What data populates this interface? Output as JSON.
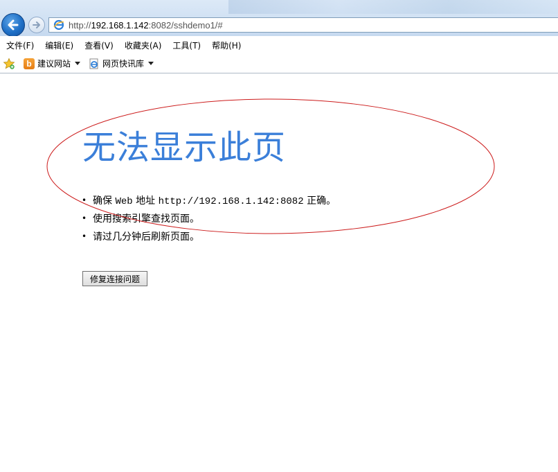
{
  "browser": {
    "url_prefix": "http://",
    "url_host": "192.168.1.142",
    "url_rest": ":8082/sshdemo1/#"
  },
  "menu": {
    "items": [
      "文件(F)",
      "编辑(E)",
      "查看(V)",
      "收藏夹(A)",
      "工具(T)",
      "帮助(H)"
    ]
  },
  "favorites": {
    "items": [
      "建议网站",
      "网页快讯库"
    ]
  },
  "content": {
    "title": "无法显示此页",
    "tips": [
      {
        "pre": "确保 ",
        "code1": "Web",
        "mid": " 地址 ",
        "code2": "http://192.168.1.142:8082",
        "post": " 正确。"
      },
      {
        "text": "使用搜索引擎查找页面。"
      },
      {
        "text": "请过几分钟后刷新页面。"
      }
    ],
    "bullet": "•",
    "fix_button": "修复连接问题"
  },
  "colors": {
    "title": "#3b7fd9",
    "annotation_ellipse": "#cc1a1a"
  }
}
